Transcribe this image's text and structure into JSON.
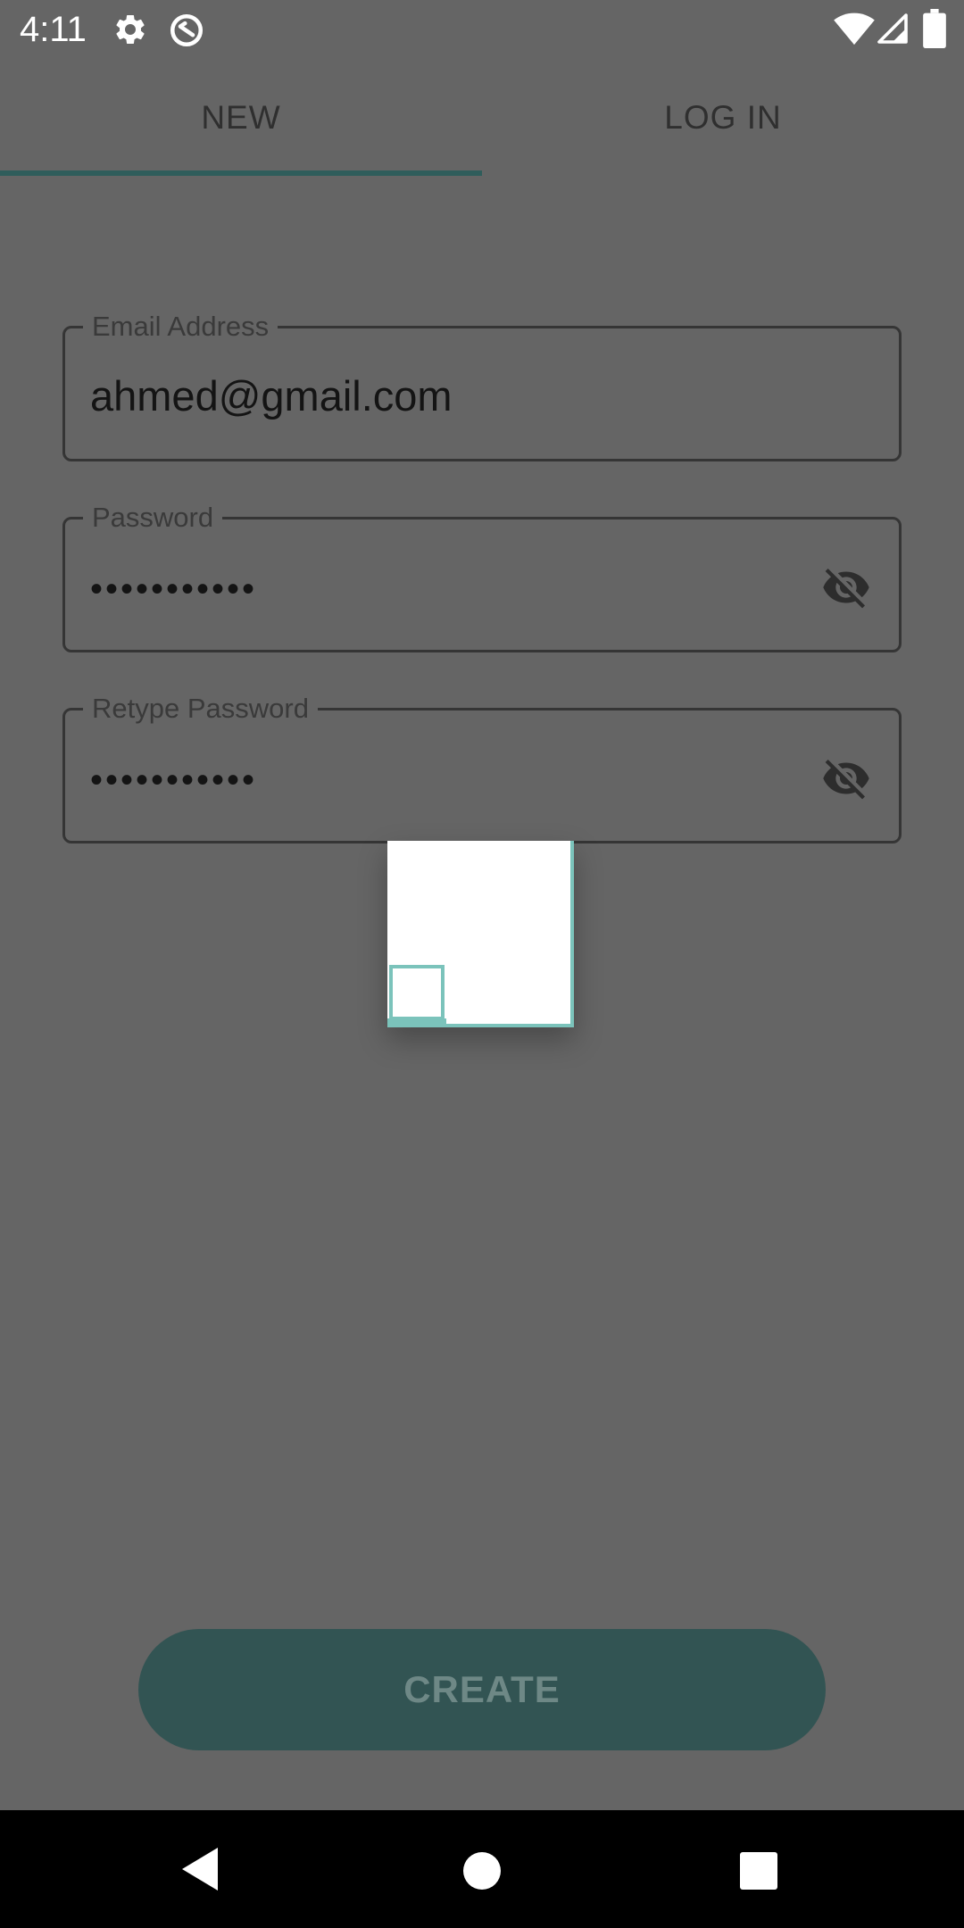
{
  "status_bar": {
    "time": "4:11",
    "left_icons": [
      "gear-icon",
      "data-saver-icon"
    ],
    "right_icons": [
      "wifi-icon",
      "cell-signal-icon",
      "battery-icon"
    ]
  },
  "tabs": [
    {
      "label": "NEW",
      "selected": true
    },
    {
      "label": "LOG IN",
      "selected": false
    }
  ],
  "form": {
    "email": {
      "label": "Email Address",
      "value": "ahmed@gmail.com"
    },
    "password": {
      "label": "Password",
      "masked_value": "•••••••••••",
      "toggle_icon": "visibility-off-icon"
    },
    "retype_password": {
      "label": "Retype Password",
      "masked_value": "•••••••••••",
      "toggle_icon": "visibility-off-icon"
    }
  },
  "create_button": {
    "label": "CREATE"
  },
  "colors": {
    "overlay_background": "#656565",
    "accent": "#2f5d5b",
    "loader_accent": "#7bc3bb",
    "button_background": "#325453"
  },
  "nav_bar": {
    "icons": [
      "back-icon",
      "home-icon",
      "recents-icon"
    ]
  }
}
